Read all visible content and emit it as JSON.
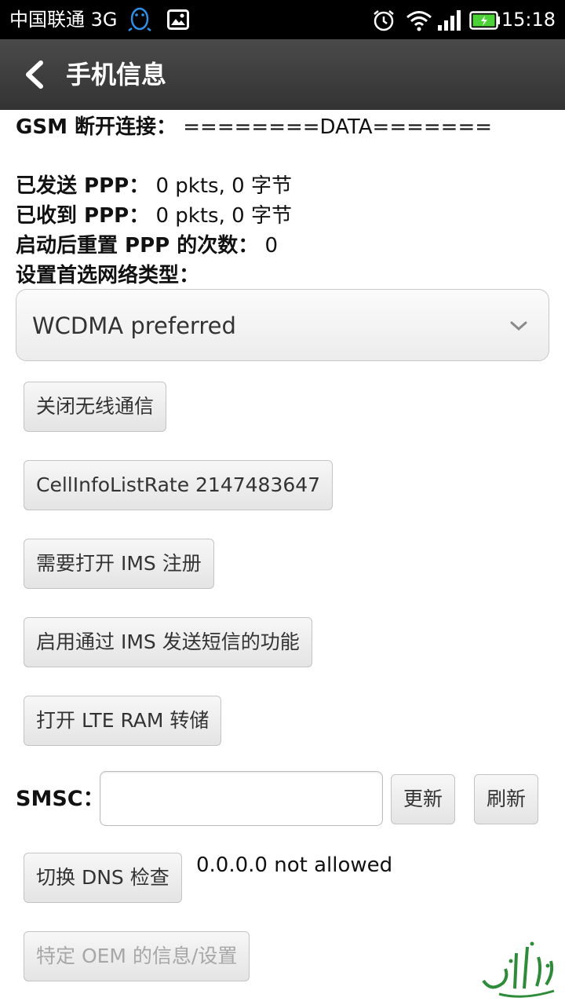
{
  "status_bar": {
    "carrier": "中国联通 3G",
    "time": "15:18"
  },
  "action_bar": {
    "title": "手机信息"
  },
  "info": {
    "gsm_label": "GSM 断开连接：",
    "gsm_value": "========DATA=======",
    "ppp_sent_label": "已发送 PPP：",
    "ppp_sent_value": "0 pkts, 0 字节",
    "ppp_recv_label": "已收到 PPP：",
    "ppp_recv_value": "0 pkts, 0 字节",
    "ppp_reset_label": "启动后重置 PPP 的次数：",
    "ppp_reset_value": "0",
    "network_type_label": "设置首选网络类型："
  },
  "network_type_select": {
    "value": "WCDMA preferred"
  },
  "buttons": {
    "radio_off": "关闭无线通信",
    "cell_info_rate": "CellInfoListRate 2147483647",
    "ims_register": "需要打开 IMS 注册",
    "sms_over_ims": "启用通过 IMS 发送短信的功能",
    "lte_ram_dump": "打开 LTE RAM 转储",
    "smsc_update": "更新",
    "smsc_refresh": "刷新",
    "dns_check": "切换 DNS 检查",
    "oem_info": "特定 OEM 的信息/设置"
  },
  "smsc": {
    "label": "SMSC：",
    "value": ""
  },
  "dns": {
    "result": "0.0.0.0 not allowed"
  },
  "colors": {
    "status_bar_bg": "#000000",
    "action_bar_bg": "#3d3d3d",
    "battery_fill": "#4cd137",
    "disabled_text": "#a7a7a7",
    "watermark": "#2e8b3a"
  },
  "icons": {
    "status_left": [
      "qq-penguin-icon",
      "image-notification-icon"
    ],
    "status_right": [
      "alarm-icon",
      "wifi-icon",
      "signal-icon",
      "battery-icon"
    ],
    "action_bar": "back-arrow-icon",
    "spinner": "chevron-down-icon"
  }
}
